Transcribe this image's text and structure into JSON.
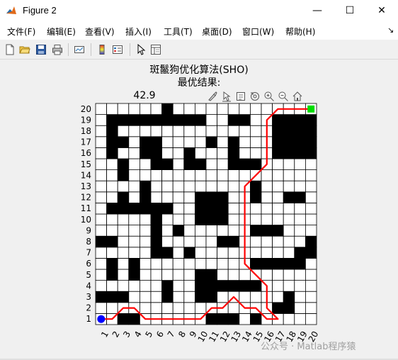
{
  "window": {
    "title": "Figure 2",
    "minimize_glyph": "—",
    "maximize_glyph": "☐",
    "close_glyph": "✕"
  },
  "menu": [
    {
      "label": "文件(F)"
    },
    {
      "label": "编辑(E)"
    },
    {
      "label": "查看(V)"
    },
    {
      "label": "插入(I)"
    },
    {
      "label": "工具(T)"
    },
    {
      "label": "桌面(D)"
    },
    {
      "label": "窗口(W)"
    },
    {
      "label": "帮助(H)"
    }
  ],
  "toolbar_icons": [
    "new-figure-icon",
    "open-file-icon",
    "save-icon",
    "print-icon",
    "link-plot-icon",
    "insert-colorbar-icon",
    "insert-legend-icon",
    "edit-plot-pointer-icon",
    "property-inspector-icon"
  ],
  "figure": {
    "title_line1": "斑鬣狗优化算法(SHO)",
    "title_line2": "最优结果:",
    "title_line3_visible": "42.9"
  },
  "axes_toolbar_icons": [
    "brush-icon",
    "data-cursor-icon",
    "export-icon",
    "rotate-icon",
    "zoom-in-icon",
    "zoom-out-icon",
    "home-icon"
  ],
  "watermark": "公众号 · Matlab程序猿",
  "chart_data": {
    "type": "heatmap",
    "grid_size": 20,
    "x_tick_labels": [
      "1",
      "2",
      "3",
      "4",
      "5",
      "6",
      "7",
      "8",
      "9",
      "10",
      "11",
      "12",
      "13",
      "14",
      "15",
      "16",
      "17",
      "18",
      "19",
      "20"
    ],
    "y_tick_labels": [
      "1",
      "2",
      "3",
      "4",
      "5",
      "6",
      "7",
      "8",
      "9",
      "10",
      "11",
      "12",
      "13",
      "14",
      "15",
      "16",
      "17",
      "18",
      "19",
      "20"
    ],
    "obstacle_color": "#000000",
    "free_color": "#ffffff",
    "path_color": "#ff0000",
    "start_color": "#0000ff",
    "goal_color": "#00dd00",
    "start": [
      1,
      1
    ],
    "goal": [
      20,
      20
    ],
    "obstacles": [
      [
        3,
        1
      ],
      [
        4,
        1
      ],
      [
        11,
        1
      ],
      [
        12,
        1
      ],
      [
        13,
        1
      ],
      [
        15,
        1
      ],
      [
        17,
        2
      ],
      [
        18,
        2
      ],
      [
        1,
        3
      ],
      [
        2,
        3
      ],
      [
        3,
        3
      ],
      [
        7,
        3
      ],
      [
        10,
        3
      ],
      [
        11,
        3
      ],
      [
        18,
        3
      ],
      [
        7,
        4
      ],
      [
        10,
        4
      ],
      [
        11,
        4
      ],
      [
        12,
        4
      ],
      [
        13,
        4
      ],
      [
        14,
        4
      ],
      [
        15,
        4
      ],
      [
        2,
        5
      ],
      [
        4,
        5
      ],
      [
        10,
        5
      ],
      [
        11,
        5
      ],
      [
        2,
        6
      ],
      [
        4,
        6
      ],
      [
        15,
        6
      ],
      [
        16,
        6
      ],
      [
        17,
        6
      ],
      [
        18,
        6
      ],
      [
        19,
        6
      ],
      [
        6,
        7
      ],
      [
        7,
        7
      ],
      [
        9,
        7
      ],
      [
        19,
        7
      ],
      [
        20,
        7
      ],
      [
        1,
        8
      ],
      [
        2,
        8
      ],
      [
        6,
        8
      ],
      [
        12,
        8
      ],
      [
        13,
        8
      ],
      [
        20,
        8
      ],
      [
        6,
        9
      ],
      [
        8,
        9
      ],
      [
        15,
        9
      ],
      [
        16,
        9
      ],
      [
        17,
        9
      ],
      [
        6,
        10
      ],
      [
        10,
        10
      ],
      [
        11,
        10
      ],
      [
        12,
        10
      ],
      [
        2,
        11
      ],
      [
        3,
        11
      ],
      [
        4,
        11
      ],
      [
        5,
        11
      ],
      [
        6,
        11
      ],
      [
        7,
        11
      ],
      [
        10,
        11
      ],
      [
        11,
        11
      ],
      [
        12,
        11
      ],
      [
        3,
        12
      ],
      [
        5,
        12
      ],
      [
        10,
        12
      ],
      [
        11,
        12
      ],
      [
        12,
        12
      ],
      [
        15,
        12
      ],
      [
        18,
        12
      ],
      [
        19,
        12
      ],
      [
        5,
        13
      ],
      [
        15,
        13
      ],
      [
        3,
        14
      ],
      [
        3,
        15
      ],
      [
        6,
        15
      ],
      [
        7,
        15
      ],
      [
        9,
        15
      ],
      [
        10,
        15
      ],
      [
        13,
        15
      ],
      [
        14,
        15
      ],
      [
        15,
        15
      ],
      [
        2,
        16
      ],
      [
        5,
        16
      ],
      [
        6,
        16
      ],
      [
        9,
        16
      ],
      [
        13,
        16
      ],
      [
        17,
        16
      ],
      [
        18,
        16
      ],
      [
        19,
        16
      ],
      [
        20,
        16
      ],
      [
        2,
        17
      ],
      [
        3,
        17
      ],
      [
        5,
        17
      ],
      [
        6,
        17
      ],
      [
        11,
        17
      ],
      [
        13,
        17
      ],
      [
        17,
        17
      ],
      [
        18,
        17
      ],
      [
        19,
        17
      ],
      [
        20,
        17
      ],
      [
        2,
        18
      ],
      [
        17,
        18
      ],
      [
        18,
        18
      ],
      [
        19,
        18
      ],
      [
        20,
        18
      ],
      [
        2,
        19
      ],
      [
        3,
        19
      ],
      [
        4,
        19
      ],
      [
        5,
        19
      ],
      [
        6,
        19
      ],
      [
        7,
        19
      ],
      [
        8,
        19
      ],
      [
        9,
        19
      ],
      [
        10,
        19
      ],
      [
        13,
        19
      ],
      [
        14,
        19
      ],
      [
        17,
        19
      ],
      [
        18,
        19
      ],
      [
        19,
        19
      ],
      [
        20,
        19
      ],
      [
        7,
        20
      ]
    ],
    "path": [
      [
        1,
        1
      ],
      [
        2,
        1
      ],
      [
        3,
        2
      ],
      [
        4,
        2
      ],
      [
        5,
        1
      ],
      [
        6,
        1
      ],
      [
        7,
        1
      ],
      [
        8,
        1
      ],
      [
        9,
        1
      ],
      [
        10,
        1
      ],
      [
        11,
        2
      ],
      [
        12,
        2
      ],
      [
        13,
        3
      ],
      [
        14,
        2
      ],
      [
        15,
        2
      ],
      [
        16,
        1
      ],
      [
        17,
        1
      ],
      [
        16,
        2
      ],
      [
        16,
        4
      ],
      [
        15,
        5
      ],
      [
        14,
        6
      ],
      [
        14,
        13
      ],
      [
        16,
        15
      ],
      [
        16,
        19
      ],
      [
        17,
        20
      ],
      [
        20,
        20
      ]
    ]
  }
}
